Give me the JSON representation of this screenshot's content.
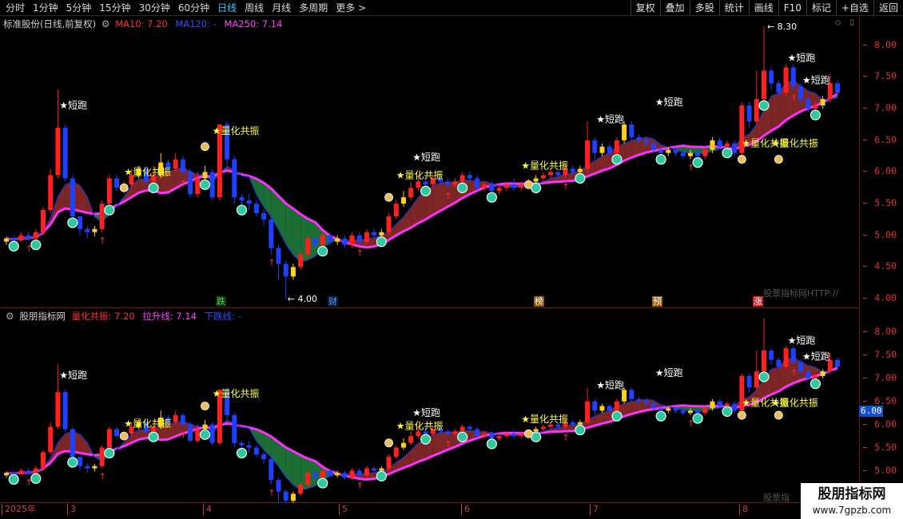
{
  "toolbar": {
    "periods": [
      "分时",
      "1分钟",
      "5分钟",
      "15分钟",
      "30分钟",
      "60分钟",
      "日线",
      "周线",
      "月线",
      "多周期",
      "更多 >"
    ],
    "active_period": "日线",
    "right_buttons": [
      "复权",
      "叠加",
      "多股",
      "统计",
      "画线",
      "F10",
      "标记",
      "+自选",
      "返回"
    ]
  },
  "main_panel": {
    "title": "标准股份(日线,前复权)",
    "ma10_label": "MA10: 7.20",
    "ma120_label": "MA120: -",
    "ma250_label": "MA250: 7.14",
    "high_label": "8.30",
    "low_label": "4.00",
    "yticks": [
      "8.00",
      "7.50",
      "7.00",
      "6.50",
      "6.00",
      "5.50",
      "5.00",
      "4.50",
      "4.00"
    ],
    "events": [
      "跌",
      "财",
      "榜",
      "预",
      "涨"
    ],
    "watermark": "股票指标网HTTP://",
    "signals": {
      "short_run": "短跑",
      "resonance": "量化共振"
    }
  },
  "sub_panel": {
    "title": "股朋指标网",
    "resonance_label": "量化共振: 7.20",
    "lift_label": "拉升线: 7.14",
    "down_label": "下跌线: -",
    "yticks": [
      "8.00",
      "7.50",
      "7.00",
      "6.50",
      "6.00",
      "5.50",
      "5.00"
    ],
    "current_value": "6.00",
    "watermark": "股票指",
    "signals": {
      "short_run": "短跑",
      "resonance": "量化共振"
    }
  },
  "date_axis": {
    "labels": [
      "2025年",
      "3",
      "4",
      "5",
      "6",
      "7",
      "8"
    ]
  },
  "brand": {
    "name": "股朋指标网",
    "url": "www.7gpzb.com"
  },
  "colors": {
    "up": "#ff2020",
    "down": "#2040ff",
    "ma10": "#ff2020",
    "ma120": "#2040ff",
    "ma250": "#ff30ff",
    "bull_fill": "#8b2a2a",
    "bear_fill": "#1f7a3a",
    "signal": "#ffff40"
  },
  "chart_data": {
    "type": "candlestick",
    "title": "标准股份(日线,前复权)",
    "ylim": [
      3.85,
      8.45
    ],
    "x_periods": [
      "2025年",
      "3",
      "4",
      "5",
      "6",
      "7",
      "8"
    ],
    "candles": [
      [
        4.9,
        4.95,
        4.85,
        4.98
      ],
      [
        4.95,
        4.92,
        4.88,
        5.0
      ],
      [
        4.92,
        5.0,
        4.9,
        5.05
      ],
      [
        5.0,
        4.95,
        4.92,
        5.05
      ],
      [
        4.95,
        5.05,
        4.9,
        5.1
      ],
      [
        5.05,
        5.4,
        5.0,
        5.45
      ],
      [
        5.4,
        5.95,
        5.35,
        6.05
      ],
      [
        5.95,
        6.7,
        5.9,
        7.3
      ],
      [
        6.7,
        5.9,
        5.85,
        6.75
      ],
      [
        5.9,
        5.3,
        5.25,
        5.95
      ],
      [
        5.3,
        5.1,
        5.0,
        5.3
      ],
      [
        5.1,
        5.05,
        4.95,
        5.15
      ],
      [
        5.05,
        5.1,
        4.98,
        5.15
      ],
      [
        5.1,
        5.5,
        5.05,
        5.55
      ],
      [
        5.5,
        5.9,
        5.45,
        5.95
      ],
      [
        5.9,
        5.75,
        5.7,
        5.95
      ],
      [
        5.75,
        5.8,
        5.7,
        5.85
      ],
      [
        5.8,
        5.95,
        5.75,
        6.05
      ],
      [
        5.95,
        6.05,
        5.9,
        6.1
      ],
      [
        6.05,
        5.85,
        5.8,
        6.1
      ],
      [
        5.85,
        5.95,
        5.8,
        6.1
      ],
      [
        5.95,
        6.15,
        5.9,
        6.3
      ],
      [
        6.15,
        6.05,
        6.0,
        6.2
      ],
      [
        6.05,
        6.2,
        6.0,
        6.3
      ],
      [
        6.2,
        6.0,
        5.95,
        6.25
      ],
      [
        6.0,
        5.65,
        5.6,
        6.05
      ],
      [
        5.65,
        5.9,
        5.6,
        6.0
      ],
      [
        5.9,
        6.0,
        5.85,
        6.1
      ],
      [
        6.0,
        5.6,
        5.55,
        6.05
      ],
      [
        5.6,
        6.75,
        5.55,
        6.75
      ],
      [
        6.75,
        6.2,
        6.1,
        6.8
      ],
      [
        6.2,
        5.6,
        5.5,
        6.25
      ],
      [
        5.6,
        5.55,
        5.45,
        5.65
      ],
      [
        5.55,
        5.5,
        5.4,
        5.65
      ],
      [
        5.5,
        5.35,
        5.3,
        5.55
      ],
      [
        5.35,
        5.25,
        5.15,
        5.4
      ],
      [
        5.25,
        4.8,
        4.7,
        5.3
      ],
      [
        4.8,
        4.55,
        4.3,
        4.85
      ],
      [
        4.55,
        4.35,
        4.0,
        4.6
      ],
      [
        4.35,
        4.5,
        4.3,
        4.55
      ],
      [
        4.5,
        4.7,
        4.45,
        4.75
      ],
      [
        4.7,
        4.95,
        4.65,
        5.0
      ],
      [
        4.95,
        4.85,
        4.8,
        5.0
      ],
      [
        4.85,
        5.0,
        4.8,
        5.05
      ],
      [
        5.0,
        4.9,
        4.85,
        5.05
      ],
      [
        4.9,
        4.95,
        4.85,
        5.0
      ],
      [
        4.95,
        4.85,
        4.8,
        5.0
      ],
      [
        4.85,
        5.0,
        4.8,
        5.05
      ],
      [
        5.0,
        4.9,
        4.85,
        5.05
      ],
      [
        4.9,
        5.05,
        4.85,
        5.1
      ],
      [
        5.05,
        5.0,
        4.95,
        5.1
      ],
      [
        5.0,
        5.05,
        4.95,
        5.1
      ],
      [
        5.05,
        5.3,
        5.0,
        5.35
      ],
      [
        5.3,
        5.5,
        5.25,
        5.55
      ],
      [
        5.5,
        5.6,
        5.45,
        5.7
      ],
      [
        5.6,
        5.75,
        5.55,
        5.85
      ],
      [
        5.75,
        5.85,
        5.7,
        5.95
      ],
      [
        5.85,
        5.8,
        5.75,
        5.95
      ],
      [
        5.8,
        5.9,
        5.75,
        5.95
      ],
      [
        5.9,
        5.85,
        5.8,
        5.95
      ],
      [
        5.85,
        5.8,
        5.75,
        5.9
      ],
      [
        5.8,
        5.85,
        5.75,
        5.9
      ],
      [
        5.85,
        5.95,
        5.8,
        6.0
      ],
      [
        5.95,
        5.9,
        5.85,
        6.0
      ],
      [
        5.9,
        5.75,
        5.7,
        5.95
      ],
      [
        5.75,
        5.8,
        5.7,
        5.85
      ],
      [
        5.8,
        5.7,
        5.65,
        5.85
      ],
      [
        5.7,
        5.75,
        5.65,
        5.8
      ],
      [
        5.75,
        5.8,
        5.7,
        5.85
      ],
      [
        5.8,
        5.75,
        5.7,
        5.9
      ],
      [
        5.75,
        5.8,
        5.7,
        5.85
      ],
      [
        5.8,
        5.85,
        5.75,
        5.9
      ],
      [
        5.85,
        5.9,
        5.8,
        5.95
      ],
      [
        5.9,
        5.95,
        5.85,
        6.0
      ],
      [
        5.95,
        6.0,
        5.9,
        6.05
      ],
      [
        6.0,
        5.95,
        5.9,
        6.05
      ],
      [
        5.95,
        6.05,
        5.9,
        6.1
      ],
      [
        6.05,
        6.0,
        5.95,
        6.1
      ],
      [
        6.0,
        6.05,
        5.95,
        6.1
      ],
      [
        6.05,
        6.5,
        6.0,
        6.8
      ],
      [
        6.5,
        6.3,
        6.2,
        6.55
      ],
      [
        6.3,
        6.4,
        6.25,
        6.45
      ],
      [
        6.4,
        6.3,
        6.25,
        6.45
      ],
      [
        6.3,
        6.5,
        6.25,
        6.55
      ],
      [
        6.5,
        6.75,
        6.45,
        6.8
      ],
      [
        6.75,
        6.55,
        6.5,
        6.8
      ],
      [
        6.55,
        6.5,
        6.45,
        6.6
      ],
      [
        6.5,
        6.45,
        6.4,
        6.55
      ],
      [
        6.45,
        6.35,
        6.3,
        6.5
      ],
      [
        6.35,
        6.3,
        6.25,
        6.4
      ],
      [
        6.3,
        6.35,
        6.25,
        6.4
      ],
      [
        6.35,
        6.3,
        6.25,
        6.4
      ],
      [
        6.3,
        6.25,
        6.2,
        6.35
      ],
      [
        6.25,
        6.3,
        6.2,
        6.35
      ],
      [
        6.3,
        6.25,
        6.2,
        6.35
      ],
      [
        6.25,
        6.35,
        6.2,
        6.4
      ],
      [
        6.35,
        6.5,
        6.3,
        6.55
      ],
      [
        6.5,
        6.4,
        6.35,
        6.55
      ],
      [
        6.4,
        6.45,
        6.35,
        6.5
      ],
      [
        6.45,
        6.3,
        6.25,
        6.5
      ],
      [
        6.3,
        7.05,
        6.25,
        7.1
      ],
      [
        7.05,
        6.8,
        6.7,
        7.1
      ],
      [
        6.8,
        7.15,
        6.75,
        7.6
      ],
      [
        7.15,
        7.6,
        7.1,
        8.3
      ],
      [
        7.6,
        7.4,
        7.3,
        7.65
      ],
      [
        7.4,
        7.25,
        7.2,
        7.45
      ],
      [
        7.25,
        7.65,
        7.2,
        7.7
      ],
      [
        7.65,
        7.35,
        7.3,
        7.7
      ],
      [
        7.35,
        7.15,
        7.1,
        7.4
      ],
      [
        7.15,
        7.0,
        6.95,
        7.2
      ],
      [
        7.0,
        7.05,
        6.95,
        7.1
      ],
      [
        7.05,
        7.15,
        7.0,
        7.2
      ],
      [
        7.15,
        7.4,
        7.1,
        7.55
      ],
      [
        7.4,
        7.25,
        7.2,
        7.45
      ]
    ]
  }
}
